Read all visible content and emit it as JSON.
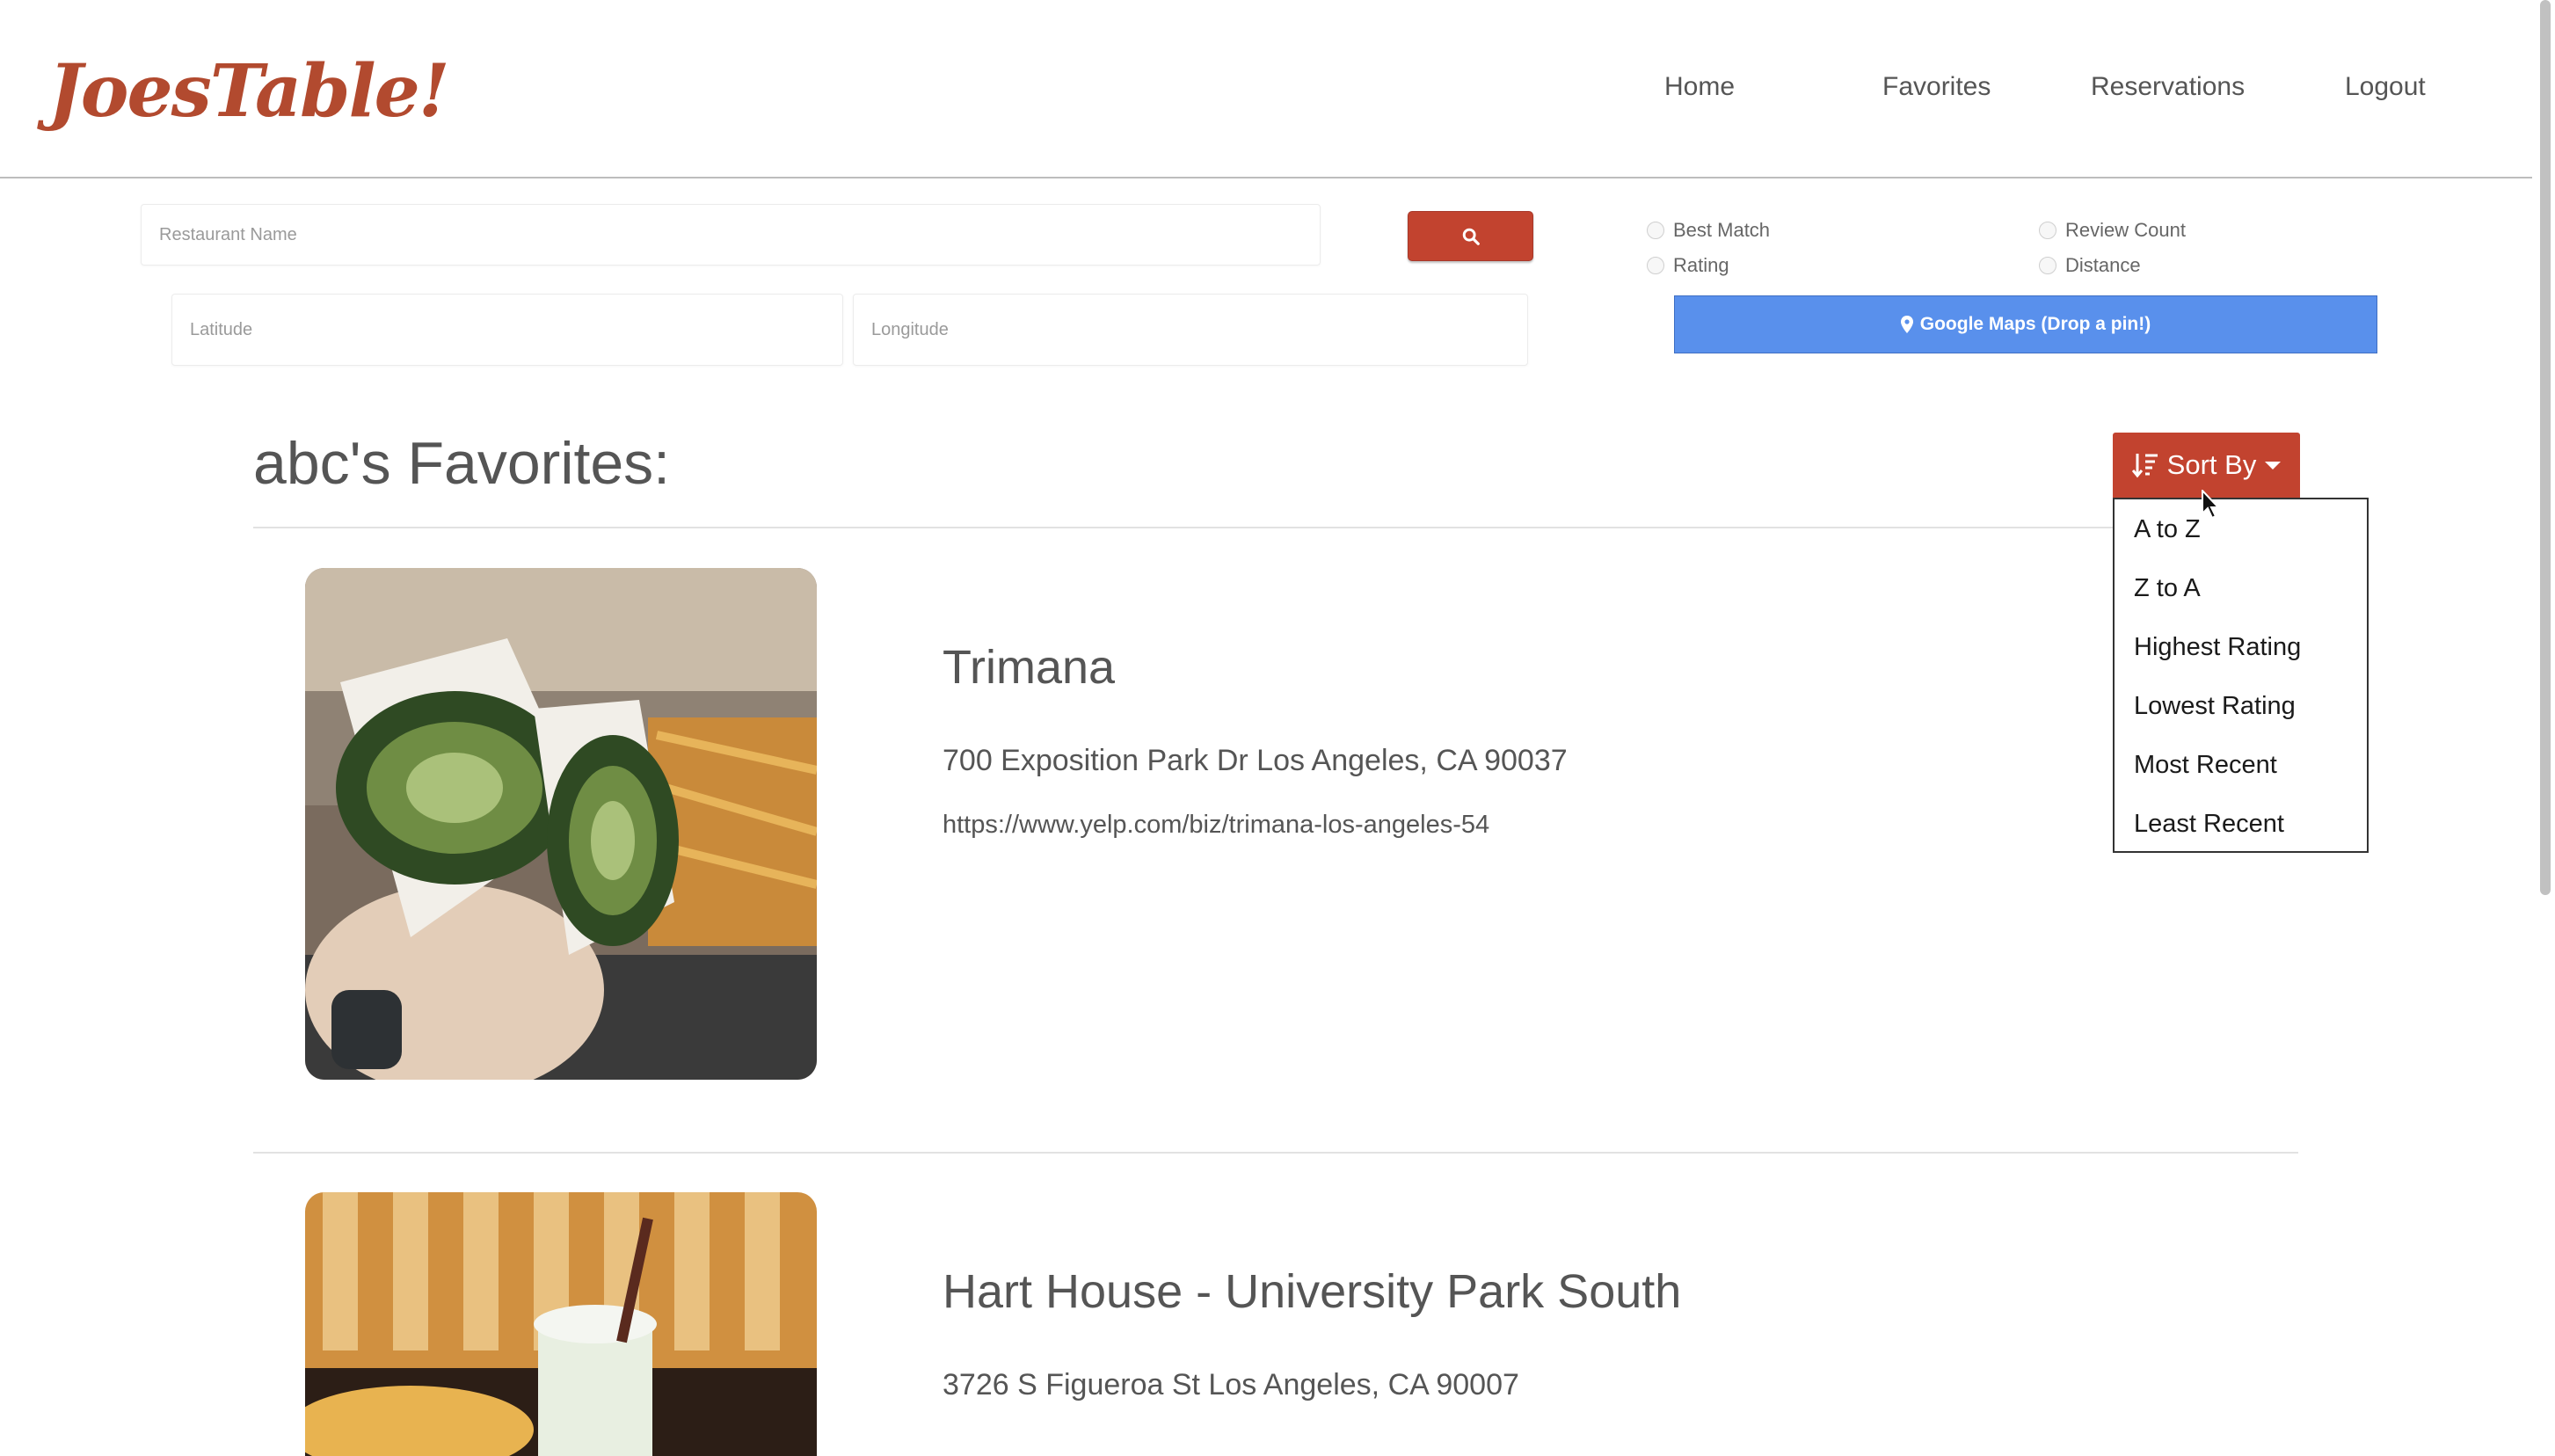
{
  "header": {
    "logo": "JoesTable!",
    "nav": [
      {
        "label": "Home"
      },
      {
        "label": "Favorites"
      },
      {
        "label": "Reservations"
      },
      {
        "label": "Logout"
      }
    ]
  },
  "search": {
    "name_placeholder": "Restaurant Name",
    "lat_placeholder": "Latitude",
    "lng_placeholder": "Longitude",
    "search_icon": "search-icon",
    "options": [
      {
        "label": "Best Match"
      },
      {
        "label": "Review Count"
      },
      {
        "label": "Rating"
      },
      {
        "label": "Distance"
      }
    ],
    "maps_button": "Google Maps (Drop a pin!)"
  },
  "favorites": {
    "title": "abc's Favorites:",
    "sort_label": "Sort By",
    "sort_options": [
      "A to Z",
      "Z to A",
      "Highest Rating",
      "Lowest Rating",
      "Most Recent",
      "Least Recent"
    ],
    "restaurants": [
      {
        "name": "Trimana",
        "address": "700 Exposition Park Dr Los Angeles, CA 90037",
        "url": "https://www.yelp.com/biz/trimana-los-angeles-54"
      },
      {
        "name": "Hart House - University Park South",
        "address": "3726 S Figueroa St Los Angeles, CA 90007"
      }
    ]
  },
  "colors": {
    "brand_red": "#c2432f",
    "logo": "#b24a2f",
    "maps_blue": "#5990ec"
  }
}
